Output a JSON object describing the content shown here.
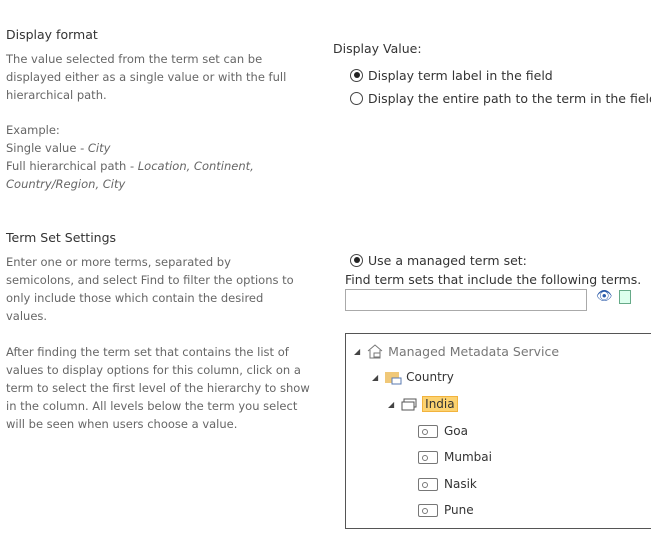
{
  "display_format": {
    "title": "Display format",
    "desc": "The value selected from the term set can be displayed either as a single value or with the full hierarchical path.",
    "example_label": "Example:",
    "single_label": "Single value - ",
    "single_value": "City",
    "full_label": "Full hierarchical path - ",
    "full_value": "Location, Continent, Country/Region, City"
  },
  "display_value": {
    "label": "Display Value:",
    "options": [
      {
        "label": "Display term label in the field",
        "selected": true
      },
      {
        "label": "Display the entire path to the term in the field",
        "selected": false
      }
    ]
  },
  "term_set": {
    "title": "Term Set Settings",
    "desc1": "Enter one or more terms, separated by semicolons, and select Find to filter the options to only include those which contain the desired values.",
    "desc2": "After finding the term set that contains the list of values to display options for this column, click on a term to select the first level of the hierarchy to show in the column. All levels below the term you select will be seen when users choose a value.",
    "use_managed": "Use a managed term set:",
    "find_label": "Find term sets that include the following terms.",
    "find_value": ""
  },
  "tree": {
    "root": "Managed Metadata Service",
    "group": "Country",
    "termset": "India",
    "terms": [
      "Goa",
      "Mumbai",
      "Nasik",
      "Pune"
    ]
  }
}
